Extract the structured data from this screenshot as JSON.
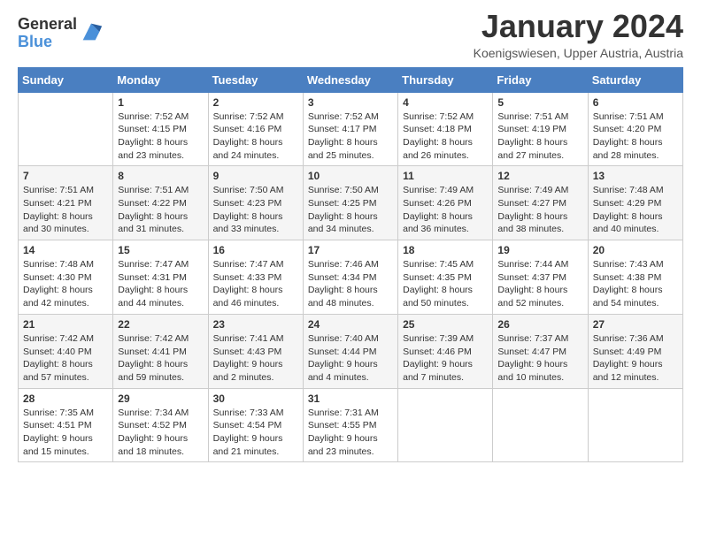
{
  "logo": {
    "line1": "General",
    "line2": "Blue"
  },
  "title": "January 2024",
  "subtitle": "Koenigswiesen, Upper Austria, Austria",
  "days_of_week": [
    "Sunday",
    "Monday",
    "Tuesday",
    "Wednesday",
    "Thursday",
    "Friday",
    "Saturday"
  ],
  "weeks": [
    [
      {
        "day": "",
        "sunrise": "",
        "sunset": "",
        "daylight": ""
      },
      {
        "day": "1",
        "sunrise": "Sunrise: 7:52 AM",
        "sunset": "Sunset: 4:15 PM",
        "daylight": "Daylight: 8 hours and 23 minutes."
      },
      {
        "day": "2",
        "sunrise": "Sunrise: 7:52 AM",
        "sunset": "Sunset: 4:16 PM",
        "daylight": "Daylight: 8 hours and 24 minutes."
      },
      {
        "day": "3",
        "sunrise": "Sunrise: 7:52 AM",
        "sunset": "Sunset: 4:17 PM",
        "daylight": "Daylight: 8 hours and 25 minutes."
      },
      {
        "day": "4",
        "sunrise": "Sunrise: 7:52 AM",
        "sunset": "Sunset: 4:18 PM",
        "daylight": "Daylight: 8 hours and 26 minutes."
      },
      {
        "day": "5",
        "sunrise": "Sunrise: 7:51 AM",
        "sunset": "Sunset: 4:19 PM",
        "daylight": "Daylight: 8 hours and 27 minutes."
      },
      {
        "day": "6",
        "sunrise": "Sunrise: 7:51 AM",
        "sunset": "Sunset: 4:20 PM",
        "daylight": "Daylight: 8 hours and 28 minutes."
      }
    ],
    [
      {
        "day": "7",
        "sunrise": "Sunrise: 7:51 AM",
        "sunset": "Sunset: 4:21 PM",
        "daylight": "Daylight: 8 hours and 30 minutes."
      },
      {
        "day": "8",
        "sunrise": "Sunrise: 7:51 AM",
        "sunset": "Sunset: 4:22 PM",
        "daylight": "Daylight: 8 hours and 31 minutes."
      },
      {
        "day": "9",
        "sunrise": "Sunrise: 7:50 AM",
        "sunset": "Sunset: 4:23 PM",
        "daylight": "Daylight: 8 hours and 33 minutes."
      },
      {
        "day": "10",
        "sunrise": "Sunrise: 7:50 AM",
        "sunset": "Sunset: 4:25 PM",
        "daylight": "Daylight: 8 hours and 34 minutes."
      },
      {
        "day": "11",
        "sunrise": "Sunrise: 7:49 AM",
        "sunset": "Sunset: 4:26 PM",
        "daylight": "Daylight: 8 hours and 36 minutes."
      },
      {
        "day": "12",
        "sunrise": "Sunrise: 7:49 AM",
        "sunset": "Sunset: 4:27 PM",
        "daylight": "Daylight: 8 hours and 38 minutes."
      },
      {
        "day": "13",
        "sunrise": "Sunrise: 7:48 AM",
        "sunset": "Sunset: 4:29 PM",
        "daylight": "Daylight: 8 hours and 40 minutes."
      }
    ],
    [
      {
        "day": "14",
        "sunrise": "Sunrise: 7:48 AM",
        "sunset": "Sunset: 4:30 PM",
        "daylight": "Daylight: 8 hours and 42 minutes."
      },
      {
        "day": "15",
        "sunrise": "Sunrise: 7:47 AM",
        "sunset": "Sunset: 4:31 PM",
        "daylight": "Daylight: 8 hours and 44 minutes."
      },
      {
        "day": "16",
        "sunrise": "Sunrise: 7:47 AM",
        "sunset": "Sunset: 4:33 PM",
        "daylight": "Daylight: 8 hours and 46 minutes."
      },
      {
        "day": "17",
        "sunrise": "Sunrise: 7:46 AM",
        "sunset": "Sunset: 4:34 PM",
        "daylight": "Daylight: 8 hours and 48 minutes."
      },
      {
        "day": "18",
        "sunrise": "Sunrise: 7:45 AM",
        "sunset": "Sunset: 4:35 PM",
        "daylight": "Daylight: 8 hours and 50 minutes."
      },
      {
        "day": "19",
        "sunrise": "Sunrise: 7:44 AM",
        "sunset": "Sunset: 4:37 PM",
        "daylight": "Daylight: 8 hours and 52 minutes."
      },
      {
        "day": "20",
        "sunrise": "Sunrise: 7:43 AM",
        "sunset": "Sunset: 4:38 PM",
        "daylight": "Daylight: 8 hours and 54 minutes."
      }
    ],
    [
      {
        "day": "21",
        "sunrise": "Sunrise: 7:42 AM",
        "sunset": "Sunset: 4:40 PM",
        "daylight": "Daylight: 8 hours and 57 minutes."
      },
      {
        "day": "22",
        "sunrise": "Sunrise: 7:42 AM",
        "sunset": "Sunset: 4:41 PM",
        "daylight": "Daylight: 8 hours and 59 minutes."
      },
      {
        "day": "23",
        "sunrise": "Sunrise: 7:41 AM",
        "sunset": "Sunset: 4:43 PM",
        "daylight": "Daylight: 9 hours and 2 minutes."
      },
      {
        "day": "24",
        "sunrise": "Sunrise: 7:40 AM",
        "sunset": "Sunset: 4:44 PM",
        "daylight": "Daylight: 9 hours and 4 minutes."
      },
      {
        "day": "25",
        "sunrise": "Sunrise: 7:39 AM",
        "sunset": "Sunset: 4:46 PM",
        "daylight": "Daylight: 9 hours and 7 minutes."
      },
      {
        "day": "26",
        "sunrise": "Sunrise: 7:37 AM",
        "sunset": "Sunset: 4:47 PM",
        "daylight": "Daylight: 9 hours and 10 minutes."
      },
      {
        "day": "27",
        "sunrise": "Sunrise: 7:36 AM",
        "sunset": "Sunset: 4:49 PM",
        "daylight": "Daylight: 9 hours and 12 minutes."
      }
    ],
    [
      {
        "day": "28",
        "sunrise": "Sunrise: 7:35 AM",
        "sunset": "Sunset: 4:51 PM",
        "daylight": "Daylight: 9 hours and 15 minutes."
      },
      {
        "day": "29",
        "sunrise": "Sunrise: 7:34 AM",
        "sunset": "Sunset: 4:52 PM",
        "daylight": "Daylight: 9 hours and 18 minutes."
      },
      {
        "day": "30",
        "sunrise": "Sunrise: 7:33 AM",
        "sunset": "Sunset: 4:54 PM",
        "daylight": "Daylight: 9 hours and 21 minutes."
      },
      {
        "day": "31",
        "sunrise": "Sunrise: 7:31 AM",
        "sunset": "Sunset: 4:55 PM",
        "daylight": "Daylight: 9 hours and 23 minutes."
      },
      {
        "day": "",
        "sunrise": "",
        "sunset": "",
        "daylight": ""
      },
      {
        "day": "",
        "sunrise": "",
        "sunset": "",
        "daylight": ""
      },
      {
        "day": "",
        "sunrise": "",
        "sunset": "",
        "daylight": ""
      }
    ]
  ]
}
